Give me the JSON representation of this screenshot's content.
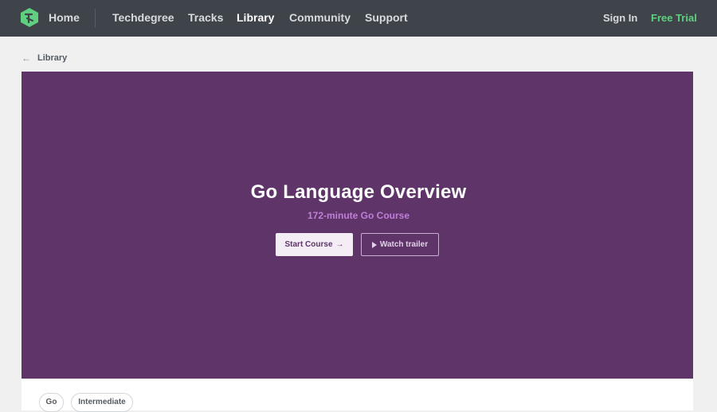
{
  "nav": {
    "home": "Home",
    "techdegree": "Techdegree",
    "tracks": "Tracks",
    "library": "Library",
    "community": "Community",
    "support": "Support",
    "sign_in": "Sign In",
    "free_trial": "Free Trial",
    "logo_icon": "treehouse-logo-icon"
  },
  "breadcrumb": {
    "label": "Library",
    "icon": "arrow-left-icon"
  },
  "hero": {
    "title": "Go Language Overview",
    "subtitle": "172-minute Go Course",
    "start_label": "Start Course",
    "start_icon": "→",
    "trailer_label": "Watch trailer",
    "trailer_icon": "play-icon"
  },
  "tags": [
    "Go",
    "Intermediate"
  ],
  "colors": {
    "nav_bg": "#3e444a",
    "hero_bg": "#5e3469",
    "subtitle": "#c07fd8",
    "accent_green": "#5fcf80"
  }
}
